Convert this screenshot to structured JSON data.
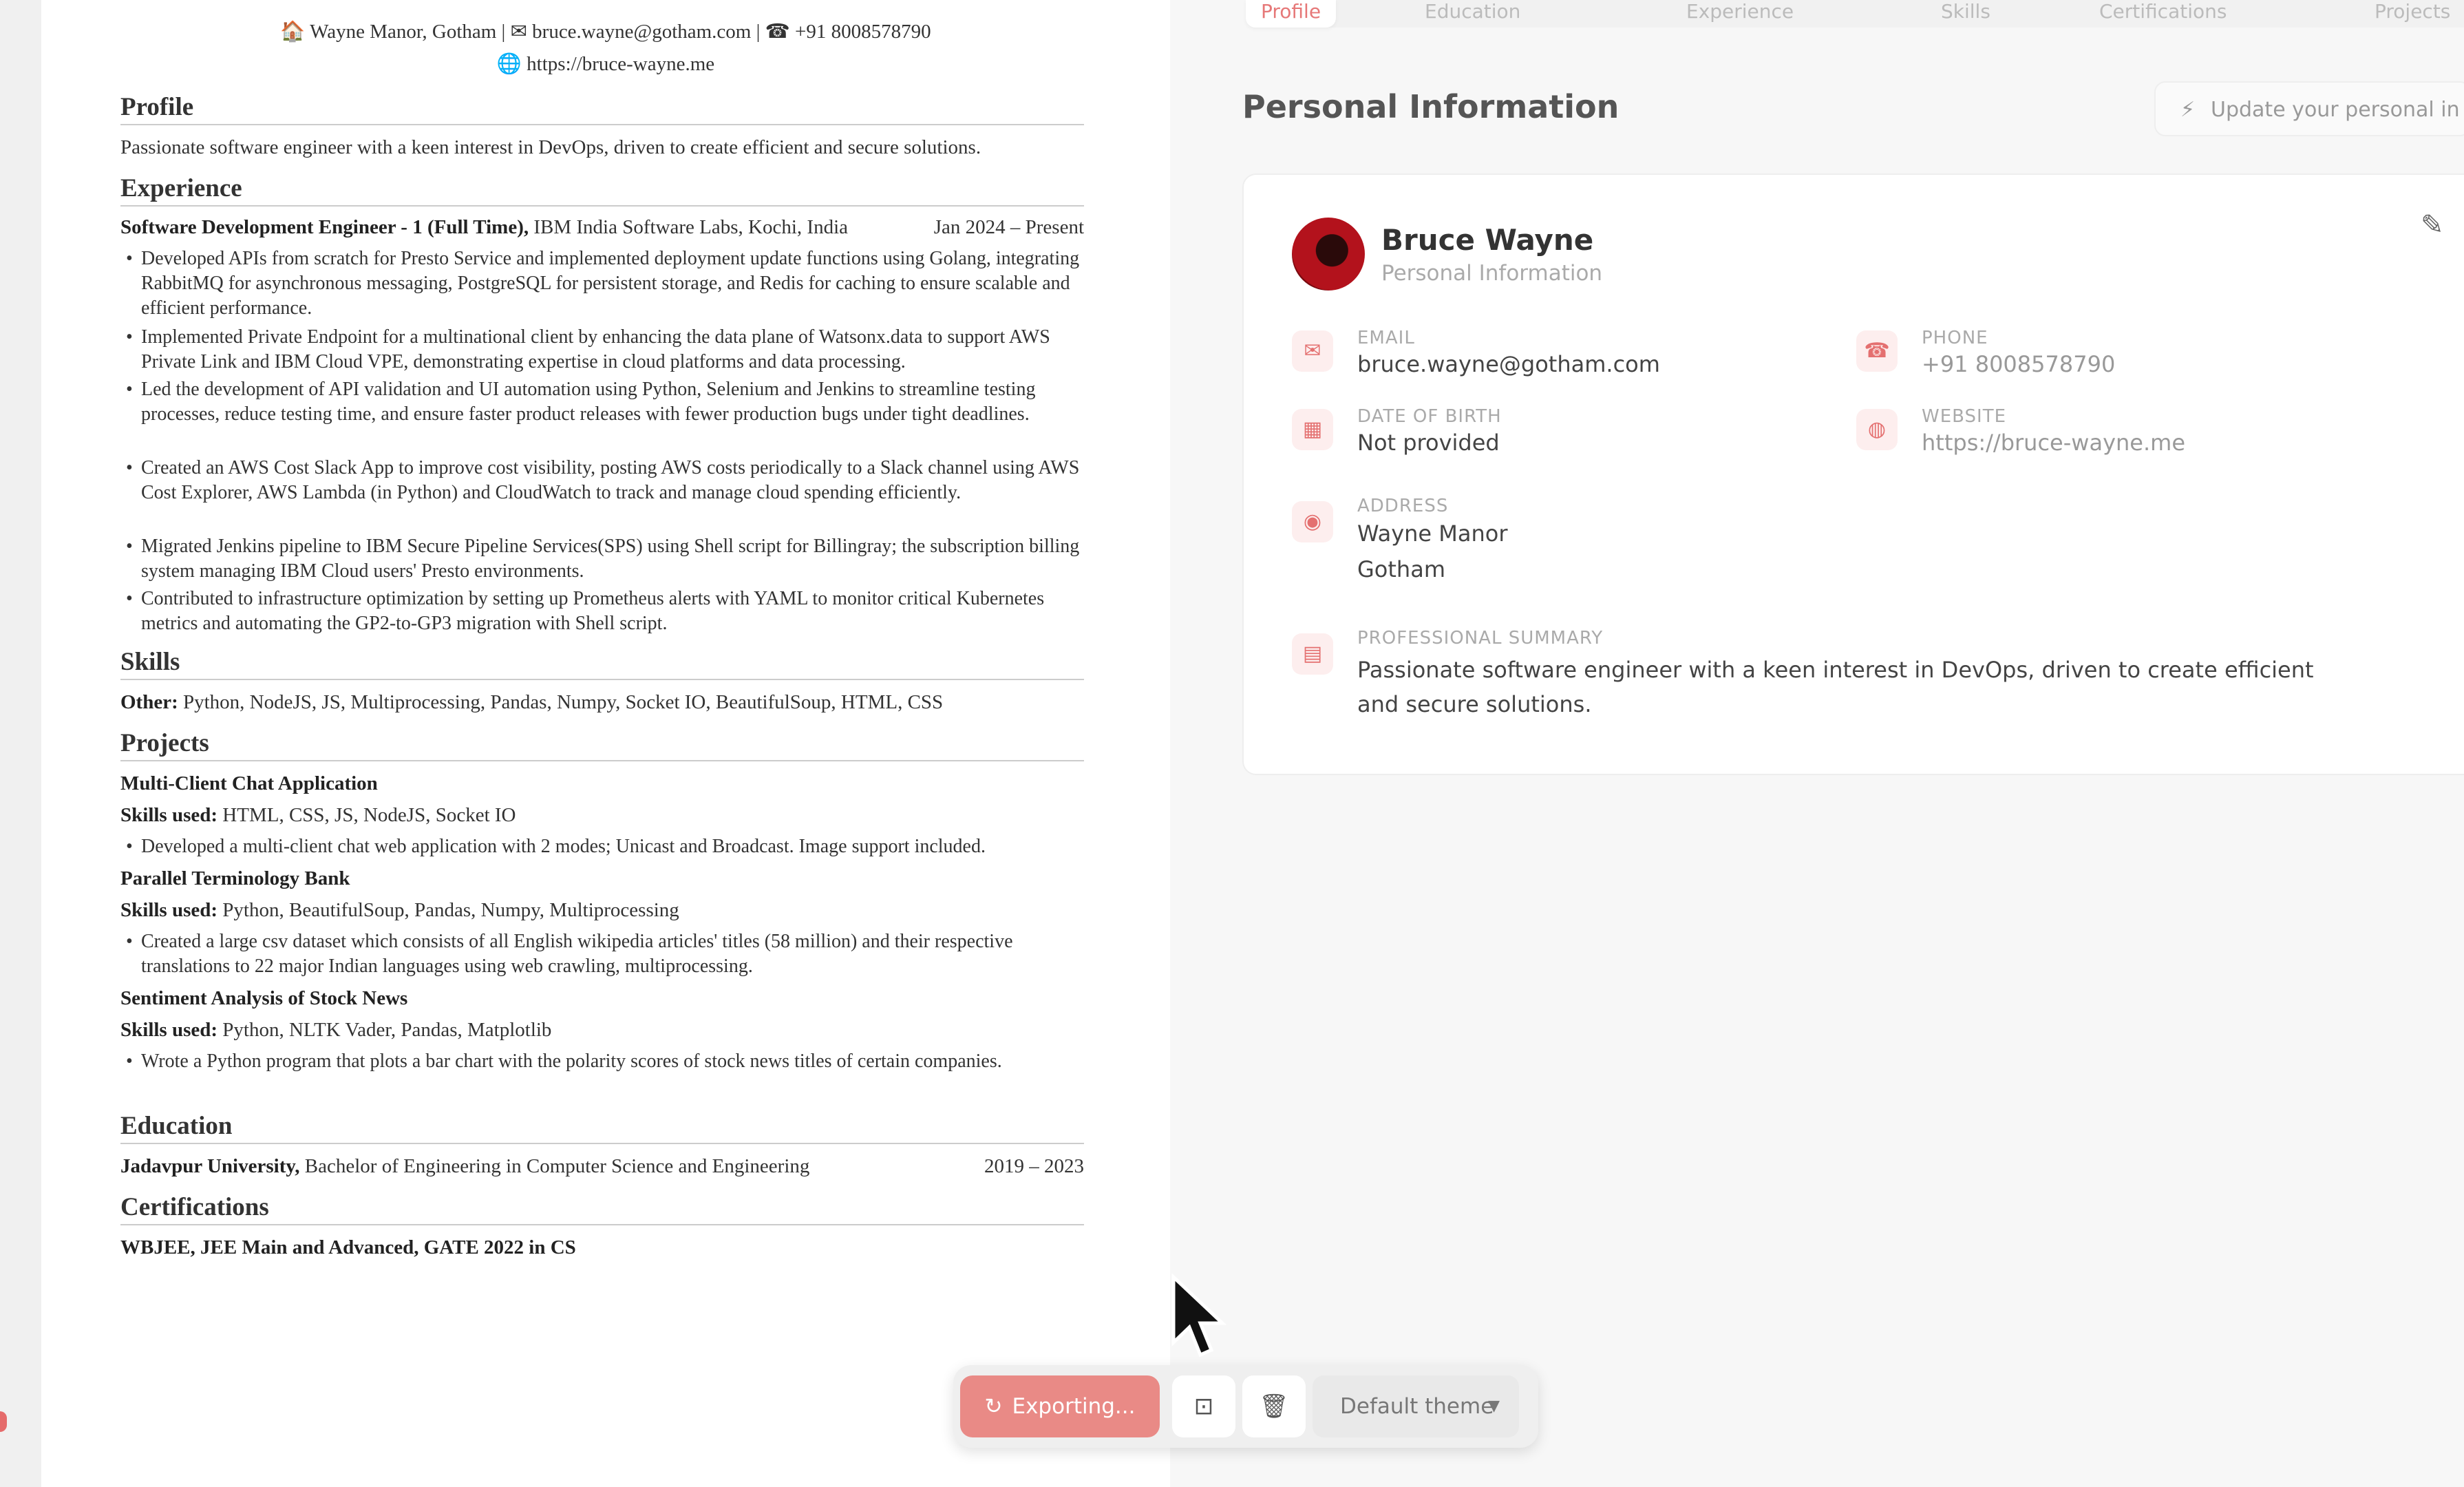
{
  "resume": {
    "contact_line": "🏠 Wayne Manor, Gotham |  ✉ bruce.wayne@gotham.com |  ☎ +91 8008578790",
    "website_line": "🌐 https://bruce-wayne.me",
    "sections": {
      "profile": "Profile",
      "experience": "Experience",
      "skills": "Skills",
      "projects": "Projects",
      "education": "Education",
      "certifications": "Certifications"
    },
    "profile_text": "Passionate software engineer with a keen interest in DevOps, driven to create efficient and secure solutions.",
    "job_title": "Software Development Engineer - 1 (Full Time),",
    "job_company": "IBM India Software Labs, Kochi, India",
    "job_dates": "Jan 2024 – Present",
    "job_bullets": [
      "Developed APIs from scratch for Presto Service and implemented deployment update functions using Golang, integrating RabbitMQ for asynchronous messaging, PostgreSQL for persistent storage, and Redis for caching to ensure scalable and efficient performance.",
      "Implemented Private Endpoint for a multinational client by enhancing the data plane of Watsonx.data to support AWS Private Link and IBM Cloud VPE, demonstrating expertise in cloud platforms and data processing.",
      "Led the development of API validation and UI automation using Python, Selenium and Jenkins to streamline testing processes, reduce testing time, and ensure faster product releases with fewer production bugs under tight deadlines.",
      "Created an AWS Cost Slack App to improve cost visibility, posting AWS costs periodically to a Slack channel using AWS Cost Explorer, AWS Lambda (in Python) and CloudWatch to track and manage cloud spending efficiently.",
      "Migrated Jenkins pipeline to IBM Secure Pipeline Services(SPS) using Shell script for Billingray; the subscription billing system managing IBM Cloud users' Presto environments.",
      "Contributed to infrastructure optimization by setting up Prometheus alerts with YAML to monitor critical Kubernetes metrics and automating the GP2-to-GP3 migration with Shell script."
    ],
    "skills_label": "Other:",
    "skills_text": "Python, NodeJS, JS, Multiprocessing, Pandas, Numpy, Socket IO, BeautifulSoup, HTML, CSS",
    "skills_used_label": "Skills used:",
    "projects": [
      {
        "title": "Multi-Client Chat Application",
        "skills": "HTML, CSS, JS, NodeJS, Socket IO",
        "bullet": "Developed a multi-client chat web application with 2 modes; Unicast and Broadcast. Image support included."
      },
      {
        "title": "Parallel Terminology Bank",
        "skills": "Python, BeautifulSoup, Pandas, Numpy, Multiprocessing",
        "bullet": "Created a large csv dataset which consists of all English wikipedia articles' titles (58 million) and their respective translations to 22 major Indian languages using web crawling, multiprocessing."
      },
      {
        "title": "Sentiment Analysis of Stock News",
        "skills": "Python, NLTK Vader, Pandas, Matplotlib",
        "bullet": "Wrote a Python program that plots a bar chart with the polarity scores of stock news titles of certain companies."
      }
    ],
    "education_school": "Jadavpur University,",
    "education_degree": "Bachelor of Engineering in Computer Science and Engineering",
    "education_dates": "2019 – 2023",
    "certifications_text": "WBJEE, JEE Main and Advanced, GATE 2022 in CS"
  },
  "editor": {
    "tabs": [
      "Profile",
      "Education",
      "Experience",
      "Skills",
      "Certifications",
      "Projects"
    ],
    "section_title": "Personal Information",
    "update_button": "Update your personal in",
    "name": "Bruce Wayne",
    "name_sub": "Personal Information",
    "fields": {
      "email_label": "EMAIL",
      "email_value": "bruce.wayne@gotham.com",
      "phone_label": "PHONE",
      "phone_value": "+91 8008578790",
      "dob_label": "DATE OF BIRTH",
      "dob_value": "Not provided",
      "website_label": "WEBSITE",
      "website_value": "https://bruce-wayne.me",
      "address_label": "ADDRESS",
      "address_line1": "Wayne Manor",
      "address_line2": "Gotham",
      "summary_label": "PROFESSIONAL SUMMARY",
      "summary_value": "Passionate software engineer with a keen interest in DevOps, driven to create efficient and secure solutions."
    }
  },
  "toolbar": {
    "export_label": "Exporting...",
    "theme_label": "Default theme"
  },
  "icons": {
    "accent": "#e67878",
    "export_bg": "#e98a86"
  }
}
